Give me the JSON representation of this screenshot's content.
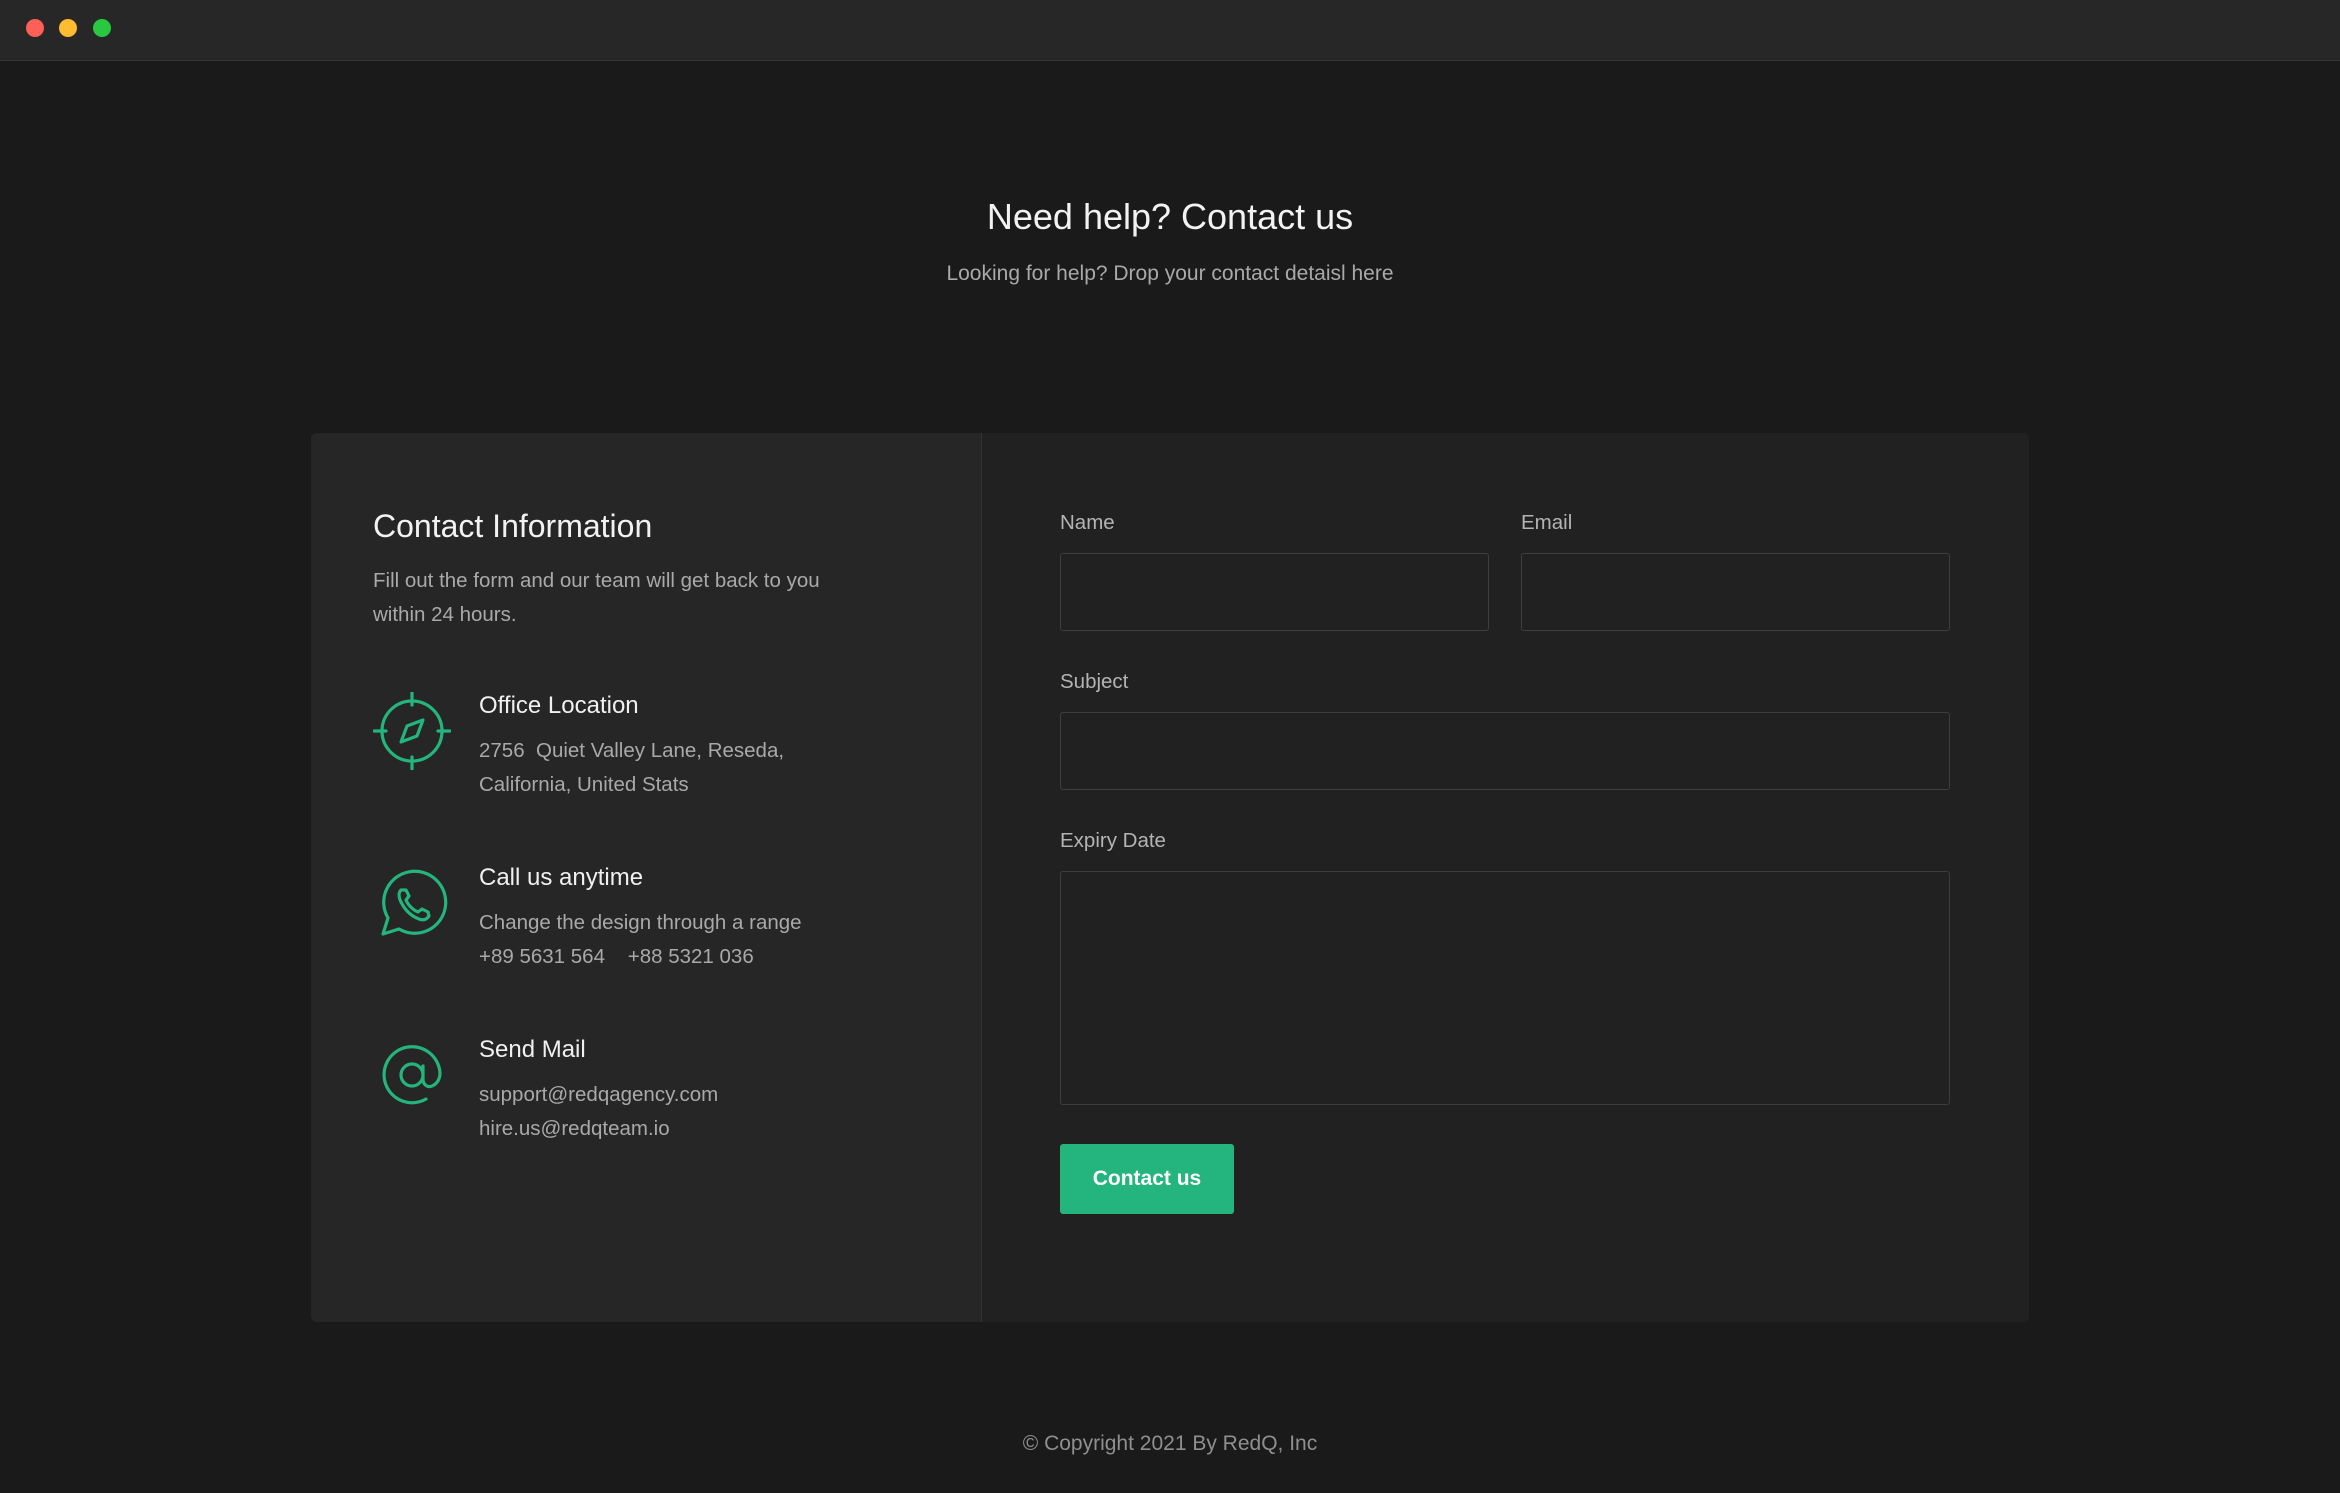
{
  "window": {
    "controls": [
      "close",
      "minimize",
      "maximize"
    ]
  },
  "header": {
    "title": "Need help? Contact us",
    "subtitle": "Looking for help? Drop your contact detaisl here"
  },
  "contact_info": {
    "title": "Contact Information",
    "description": "Fill out the form and our team will get back to you within 24 hours.",
    "items": [
      {
        "icon": "compass-icon",
        "title": "Office Location",
        "lines": [
          "2756  Quiet Valley Lane, Reseda,",
          "California, United Stats"
        ]
      },
      {
        "icon": "whatsapp-phone-icon",
        "title": "Call us anytime",
        "lines": [
          "Change the design through a range",
          "+89 5631 564    +88 5321 036"
        ]
      },
      {
        "icon": "at-sign-icon",
        "title": "Send Mail",
        "lines": [
          "support@redqagency.com",
          "hire.us@redqteam.io"
        ]
      }
    ]
  },
  "form": {
    "name_label": "Name",
    "name_value": "",
    "email_label": "Email",
    "email_value": "",
    "subject_label": "Subject",
    "subject_value": "",
    "expiry_label": "Expiry Date",
    "expiry_value": "",
    "submit_label": "Contact us"
  },
  "footer": {
    "copyright": "© Copyright 2021 By RedQ, Inc"
  },
  "colors": {
    "accent": "#24b47e",
    "background": "#1a1a1a",
    "card": "#212121",
    "card_left": "#262626"
  }
}
